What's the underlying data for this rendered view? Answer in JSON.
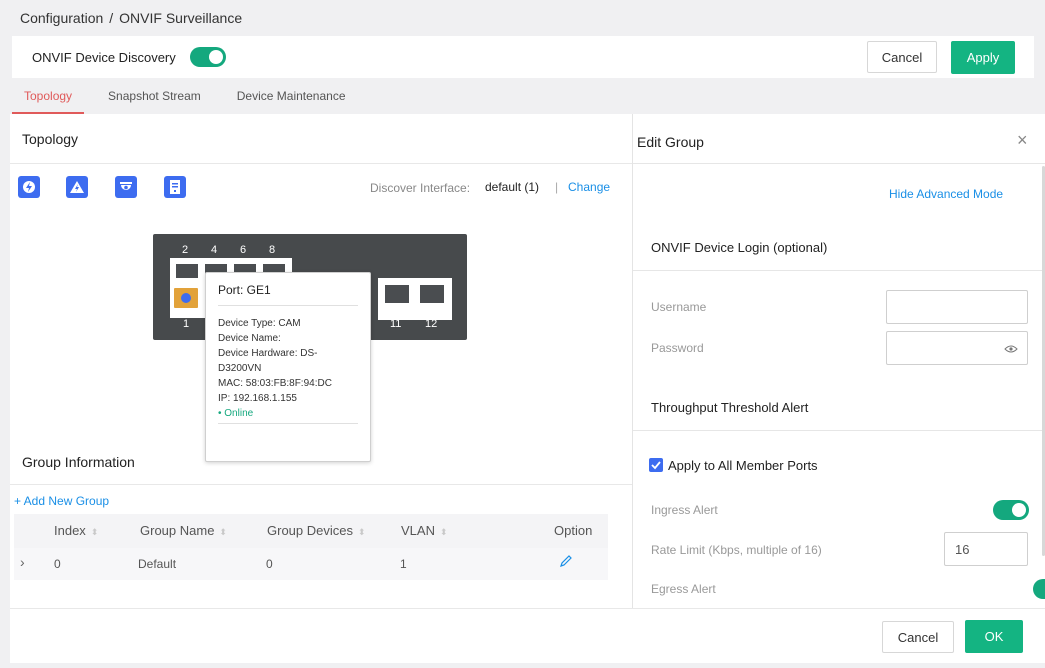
{
  "breadcrumb": {
    "parent": "Configuration",
    "separator": "/",
    "current": "ONVIF Surveillance"
  },
  "topbar": {
    "discovery_label": "ONVIF Device Discovery",
    "discovery_on": true,
    "cancel": "Cancel",
    "apply": "Apply"
  },
  "tabs": [
    {
      "label": "Topology",
      "active": true
    },
    {
      "label": "Snapshot Stream",
      "active": false
    },
    {
      "label": "Device Maintenance",
      "active": false
    }
  ],
  "topology": {
    "title": "Topology",
    "toolbar_icons": [
      "lightning-circle-icon",
      "lightning-triangle-icon",
      "camera-icon",
      "server-icon"
    ],
    "discover_label": "Discover Interface:",
    "discover_value": "default (1)",
    "discover_sep": "|",
    "change": "Change",
    "port_numbers": [
      "2",
      "4",
      "6",
      "8",
      "1",
      "11",
      "12"
    ]
  },
  "tooltip": {
    "title": "Port: GE1",
    "lines": [
      "Device Type: CAM",
      "Device Name:",
      "Device Hardware: DS-D3200VN",
      "MAC: 58:03:FB:8F:94:DC",
      "IP: 192.168.1.155"
    ],
    "status": "Online"
  },
  "group": {
    "title": "Group Information",
    "add": "+ Add New Group",
    "columns": [
      "Index",
      "Group Name",
      "Group Devices",
      "VLAN",
      "Option"
    ],
    "row": {
      "index": "0",
      "name": "Default",
      "devices": "0",
      "vlan": "1"
    }
  },
  "edit_group": {
    "title": "Edit Group",
    "hide_advanced": "Hide Advanced Mode",
    "login_title": "ONVIF Device Login (optional)",
    "username_label": "Username",
    "username_value": "",
    "password_label": "Password",
    "password_value": "",
    "threshold_title": "Throughput Threshold Alert",
    "apply_all": "Apply to All Member Ports",
    "apply_all_checked": true,
    "ingress_label": "Ingress Alert",
    "ingress_on": true,
    "rate_label": "Rate Limit (Kbps, multiple of 16)",
    "rate_value": "16",
    "egress_label": "Egress Alert",
    "egress_on": true
  },
  "footer": {
    "cancel": "Cancel",
    "ok": "OK"
  },
  "colors": {
    "accent": "#14b482",
    "tab_active": "#e05a5a",
    "link": "#1a8fe6",
    "icon_blue": "#3d6cf0",
    "online": "#14a87e"
  }
}
